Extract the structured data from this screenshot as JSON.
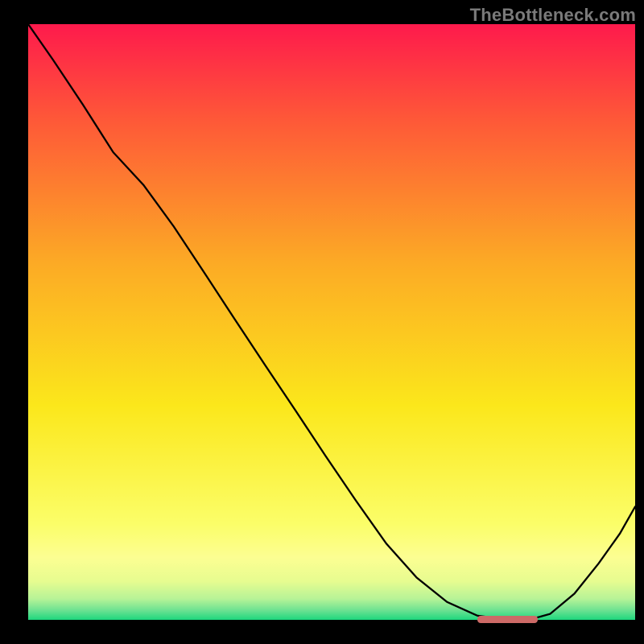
{
  "watermark": {
    "text": "TheBottleneck.com"
  },
  "chart_data": {
    "type": "line",
    "title": "",
    "xlabel": "",
    "ylabel": "",
    "xlim": [
      0,
      100
    ],
    "ylim": [
      0,
      100
    ],
    "grid": false,
    "legend": false,
    "background_gradient": {
      "direction": "vertical",
      "stops": [
        {
          "pos": 0.0,
          "color": "#fe1a4c"
        },
        {
          "pos": 0.16,
          "color": "#fe5838"
        },
        {
          "pos": 0.4,
          "color": "#fcaa25"
        },
        {
          "pos": 0.64,
          "color": "#fbe71b"
        },
        {
          "pos": 0.84,
          "color": "#fbfe69"
        },
        {
          "pos": 0.895,
          "color": "#fcfe92"
        },
        {
          "pos": 0.935,
          "color": "#e7fc90"
        },
        {
          "pos": 0.965,
          "color": "#b6f397"
        },
        {
          "pos": 0.985,
          "color": "#68e191"
        },
        {
          "pos": 1.0,
          "color": "#1dd77d"
        }
      ]
    },
    "series": [
      {
        "name": "curve",
        "color": "#000000",
        "x": [
          0.0,
          4.1,
          9.0,
          14.0,
          19.0,
          24.0,
          29.0,
          34.0,
          39.0,
          44.0,
          49.0,
          54.0,
          59.0,
          64.0,
          69.0,
          74.0,
          79.0,
          82.5,
          86.0,
          90.0,
          94.0,
          97.5,
          100.0
        ],
        "y": [
          100.0,
          94.0,
          86.5,
          78.5,
          73.0,
          66.0,
          58.3,
          50.5,
          42.8,
          35.2,
          27.5,
          20.0,
          12.8,
          7.1,
          3.0,
          0.7,
          0.0,
          0.0,
          1.0,
          4.4,
          9.5,
          14.5,
          19.0
        ]
      }
    ],
    "marker": {
      "name": "optimum-range",
      "color": "#cd6a67",
      "x_start": 74.0,
      "x_end": 84.0,
      "y": 0.0
    }
  }
}
